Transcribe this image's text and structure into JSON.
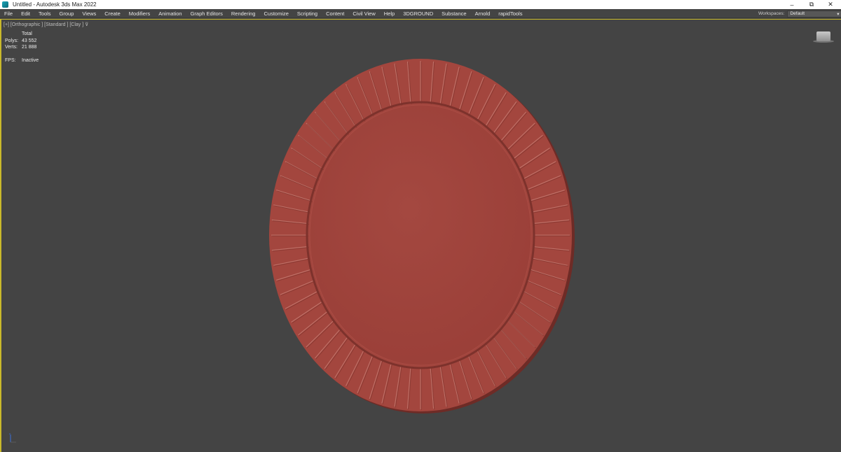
{
  "window": {
    "title": "Untitled - Autodesk 3ds Max 2022",
    "icon": "3ds-max-icon",
    "controls": {
      "minimize": "–",
      "restore": "⧉",
      "close": "✕"
    }
  },
  "menu": {
    "items": [
      "File",
      "Edit",
      "Tools",
      "Group",
      "Views",
      "Create",
      "Modifiers",
      "Animation",
      "Graph Editors",
      "Rendering",
      "Customize",
      "Scripting",
      "Content",
      "Civil View",
      "Help",
      "3DGROUND",
      "Substance",
      "Arnold",
      "rapidTools"
    ],
    "workspaces_label": "Workspaces:",
    "workspaces_value": "Default"
  },
  "viewport": {
    "label": "[+] [Orthographic ] [Standard ] [Clay ]",
    "filter_icon": "filter-icon",
    "stats": {
      "header": "Total",
      "polys_label": "Polys:",
      "polys_value": "43 552",
      "verts_label": "Verts:",
      "verts_value": "21 888",
      "fps_label": "FPS:",
      "fps_value": "Inactive"
    },
    "colors": {
      "background": "#444444",
      "active_border": "#c9b92a",
      "object_clay": "#a3463e"
    },
    "object": {
      "name": "round-plate-model",
      "rim_segments": 72
    }
  }
}
